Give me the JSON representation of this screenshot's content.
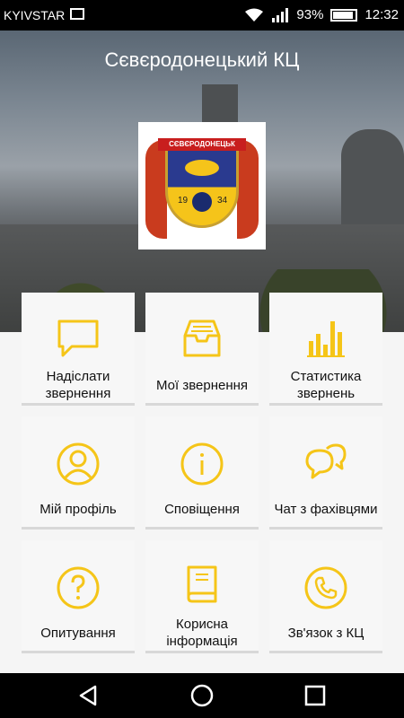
{
  "status": {
    "carrier": "KYIVSTAR",
    "battery": "93%",
    "time": "12:32"
  },
  "header": {
    "title": "Сєвєродонецький КЦ"
  },
  "emblem": {
    "banner": "СЄВЄРОДОНЕЦЬК",
    "year_left": "19",
    "year_right": "34"
  },
  "colors": {
    "accent": "#f5c518",
    "tile_bg": "#f7f7f7",
    "status_bar": "#000000"
  },
  "tiles": [
    {
      "label": "Надіслати звернення",
      "icon": "speech-bubble-icon"
    },
    {
      "label": "Мої звернення",
      "icon": "inbox-tray-icon"
    },
    {
      "label": "Статистика звернень",
      "icon": "bar-chart-icon"
    },
    {
      "label": "Мій профіль",
      "icon": "user-profile-icon"
    },
    {
      "label": "Сповіщення",
      "icon": "info-icon"
    },
    {
      "label": "Чат з фахівцями",
      "icon": "chat-bubbles-icon"
    },
    {
      "label": "Опитування",
      "icon": "question-icon"
    },
    {
      "label": "Корисна інформація",
      "icon": "book-icon"
    },
    {
      "label": "Зв'язок з КЦ",
      "icon": "phone-icon"
    }
  ]
}
